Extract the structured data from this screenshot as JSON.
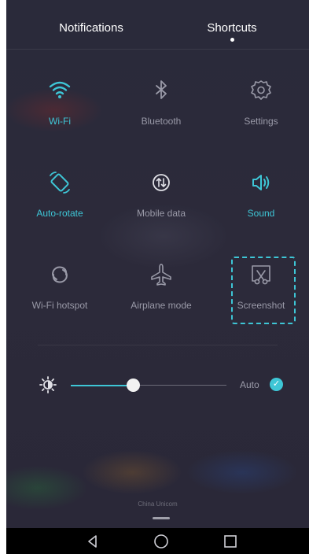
{
  "tabs": [
    {
      "label": "Notifications",
      "active": false
    },
    {
      "label": "Shortcuts",
      "active": true
    }
  ],
  "shortcuts": [
    {
      "label": "Wi-Fi",
      "icon": "wifi-icon",
      "on": true
    },
    {
      "label": "Bluetooth",
      "icon": "bluetooth-icon",
      "on": false
    },
    {
      "label": "Settings",
      "icon": "gear-icon",
      "on": false
    },
    {
      "label": "Auto-rotate",
      "icon": "rotate-icon",
      "on": true
    },
    {
      "label": "Mobile data",
      "icon": "mobile-data-icon",
      "on": false
    },
    {
      "label": "Sound",
      "icon": "speaker-icon",
      "on": true
    },
    {
      "label": "Wi-Fi hotspot",
      "icon": "hotspot-icon",
      "on": false
    },
    {
      "label": "Airplane mode",
      "icon": "airplane-icon",
      "on": false
    },
    {
      "label": "Screenshot",
      "icon": "scissors-icon",
      "on": false,
      "highlighted": true
    }
  ],
  "brightness": {
    "level": 0.36,
    "auto_label": "Auto",
    "auto_checked": true
  },
  "carrier": "China Unicom",
  "navbar": [
    "back-icon",
    "home-icon",
    "recents-icon"
  ],
  "colors": {
    "accent": "#3ec6d6",
    "inactive_text": "#9a9aa8",
    "panel_bg": "#2a2a3a"
  }
}
